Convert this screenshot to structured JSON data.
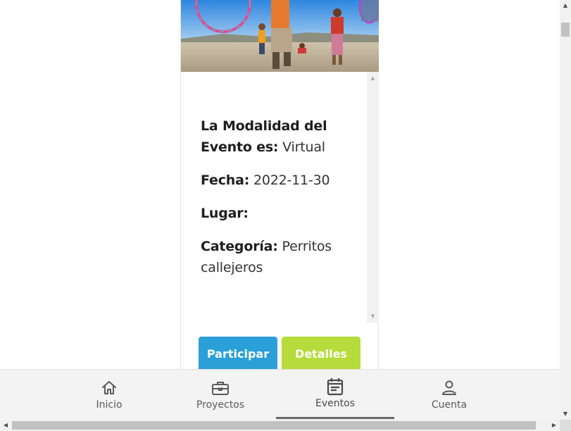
{
  "event": {
    "modalidad_label": "La Modalidad del Evento es:",
    "modalidad_value": "Virtual",
    "fecha_label": "Fecha:",
    "fecha_value": "2022-11-30",
    "lugar_label": "Lugar:",
    "lugar_value": "",
    "categoria_label": "Categoría:",
    "categoria_value": "Perritos callejeros"
  },
  "actions": {
    "participar_label": "Participar",
    "detalles_label": "Detalles"
  },
  "nav": {
    "items": [
      {
        "label": "Inicio",
        "icon": "home-icon"
      },
      {
        "label": "Proyectos",
        "icon": "briefcase-icon"
      },
      {
        "label": "Eventos",
        "icon": "calendar-icon",
        "active": true
      },
      {
        "label": "Cuenta",
        "icon": "user-icon"
      }
    ]
  },
  "colors": {
    "participar": "#2a9fd8",
    "detalles": "#b5dc3a",
    "nav_bg": "#f3f3f3"
  }
}
